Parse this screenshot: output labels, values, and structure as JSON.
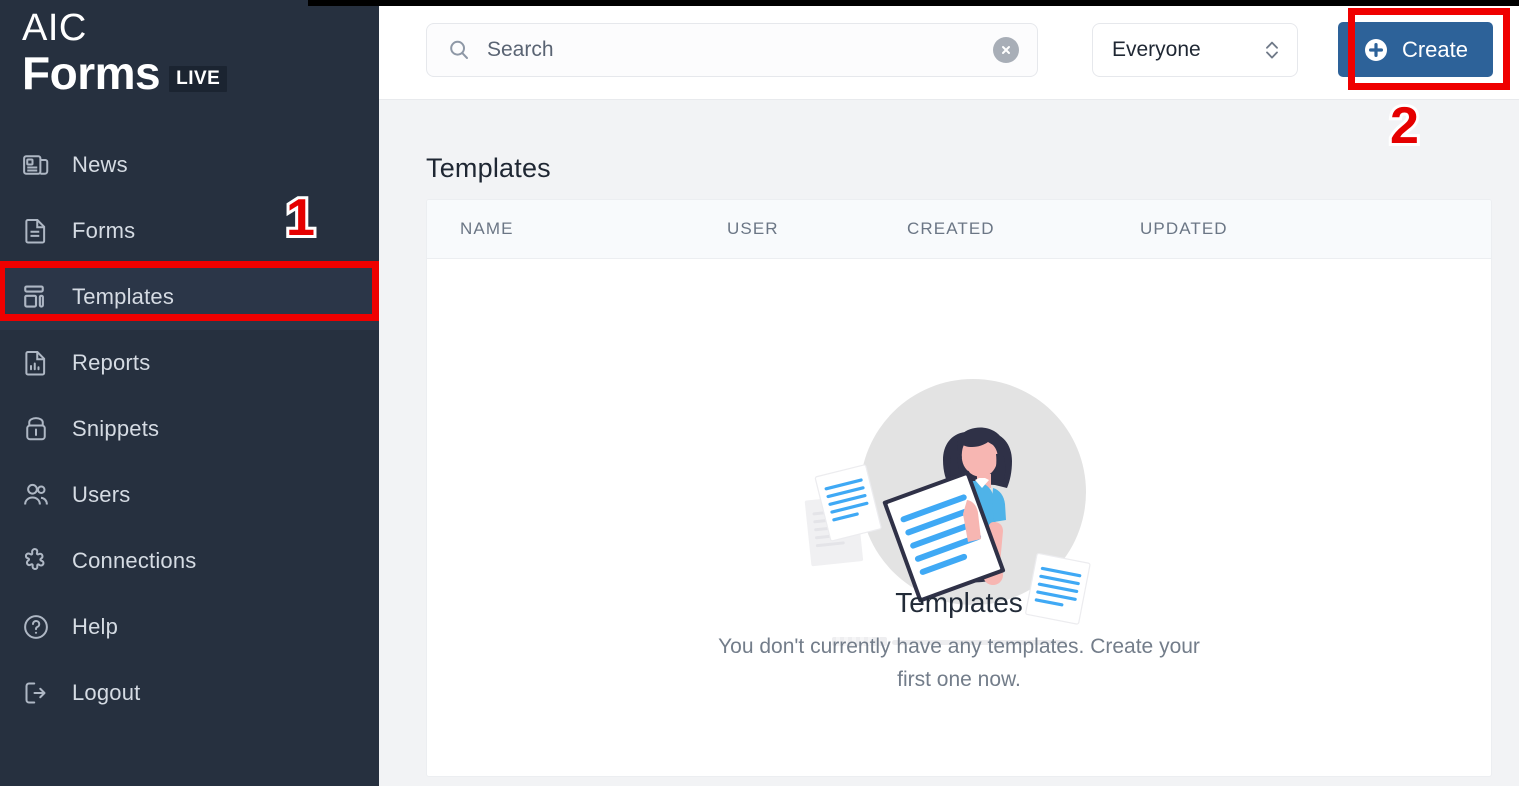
{
  "app": {
    "logo_line1": "AIC",
    "logo_line2": "Forms",
    "logo_badge": "LIVE",
    "accent_blue": "#2d6299",
    "sidebar_bg": "#26303f",
    "annotation_red": "#ef0000"
  },
  "sidebar": {
    "items": [
      {
        "label": "News",
        "icon": "newspaper-icon",
        "active": false
      },
      {
        "label": "Forms",
        "icon": "document-icon",
        "active": false
      },
      {
        "label": "Templates",
        "icon": "template-layout-icon",
        "active": true
      },
      {
        "label": "Reports",
        "icon": "report-chart-icon",
        "active": false
      },
      {
        "label": "Snippets",
        "icon": "snippet-box-icon",
        "active": false
      },
      {
        "label": "Users",
        "icon": "users-icon",
        "active": false
      },
      {
        "label": "Connections",
        "icon": "puzzle-piece-icon",
        "active": false
      },
      {
        "label": "Help",
        "icon": "question-circle-icon",
        "active": false
      },
      {
        "label": "Logout",
        "icon": "logout-arrow-icon",
        "active": false
      }
    ]
  },
  "toolbar": {
    "search": {
      "value": "",
      "placeholder": "Search",
      "icon": "search-icon",
      "clear_icon": "clear-circle-icon"
    },
    "filter_select": {
      "selected": "Everyone",
      "options": [
        "Everyone"
      ],
      "icon": "updown-chevrons-icon"
    },
    "create_button": {
      "label": "Create",
      "icon": "plus-circle-icon"
    }
  },
  "page": {
    "title": "Templates"
  },
  "table": {
    "columns": [
      "NAME",
      "USER",
      "CREATED",
      "UPDATED"
    ],
    "rows": []
  },
  "empty_state": {
    "title": "Templates",
    "message": "You don't currently have any templates. Create your first one now.",
    "illustration": "woman-holding-documents-illustration"
  },
  "annotations": {
    "step1": {
      "number": "1",
      "target": "sidebar-item-templates"
    },
    "step2": {
      "number": "2",
      "target": "create-button"
    }
  }
}
